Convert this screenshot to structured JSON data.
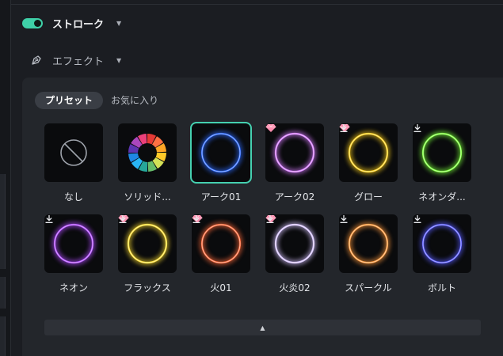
{
  "stroke": {
    "label": "ストローク",
    "enabled": true,
    "toggle_color": "#3fd0a8"
  },
  "effect": {
    "label": "エフェクト"
  },
  "tabs": [
    {
      "label": "プリセット",
      "active": true
    },
    {
      "label": "お気に入り",
      "active": false
    }
  ],
  "presets": [
    {
      "label": "なし",
      "type": "none",
      "premium": false,
      "download": false,
      "selected": false
    },
    {
      "label": "ソリッド...",
      "type": "solid",
      "premium": false,
      "download": false,
      "selected": false
    },
    {
      "label": "アーク01",
      "type": "ring",
      "color": "#2f6bff",
      "premium": false,
      "download": false,
      "selected": true
    },
    {
      "label": "アーク02",
      "type": "ring",
      "color": "#d77cff",
      "premium": true,
      "download": false,
      "selected": false
    },
    {
      "label": "グロー",
      "type": "ring",
      "color": "#ffd21f",
      "premium": true,
      "download": true,
      "selected": false
    },
    {
      "label": "ネオンダ...",
      "type": "ring",
      "color": "#7cff3a",
      "premium": false,
      "download": true,
      "selected": false
    },
    {
      "label": "ネオン",
      "type": "ring",
      "color": "#b14cff",
      "premium": false,
      "download": true,
      "selected": false
    },
    {
      "label": "フラックス",
      "type": "ring",
      "color": "#ffe033",
      "premium": true,
      "download": true,
      "selected": false
    },
    {
      "label": "火01",
      "type": "ring",
      "color": "#ff6a3a",
      "premium": true,
      "download": true,
      "selected": false
    },
    {
      "label": "火炎02",
      "type": "ring",
      "color": "#d8c4ff",
      "premium": true,
      "download": true,
      "selected": false
    },
    {
      "label": "スパークル",
      "type": "ring",
      "color": "#ff9a3c",
      "premium": false,
      "download": true,
      "selected": false
    },
    {
      "label": "ボルト",
      "type": "ring",
      "color": "#5a5cff",
      "premium": false,
      "download": true,
      "selected": false
    }
  ],
  "collapse_icon": "caret-up-icon"
}
